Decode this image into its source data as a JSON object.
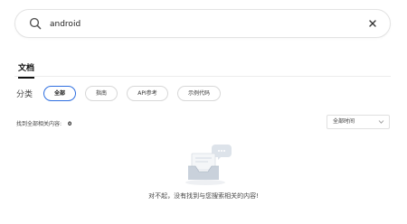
{
  "search": {
    "value": "android"
  },
  "tabs": [
    {
      "label": "文档"
    }
  ],
  "category": {
    "label": "分类",
    "chips": [
      "全部",
      "指南",
      "API参考",
      "示例代码"
    ]
  },
  "results": {
    "label": "找到全部相关内容:",
    "count": "0"
  },
  "time_filter": {
    "selected": "全部时间"
  },
  "empty": {
    "message": "对不起，没有找到与您搜索相关的内容!"
  },
  "icons": {
    "search": "search-icon",
    "clear": "close-icon",
    "dropdown": "chevron-down-icon",
    "empty": "empty-inbox-illustration"
  },
  "colors": {
    "accent": "#2f6fe0",
    "border": "#e3e3e3"
  }
}
